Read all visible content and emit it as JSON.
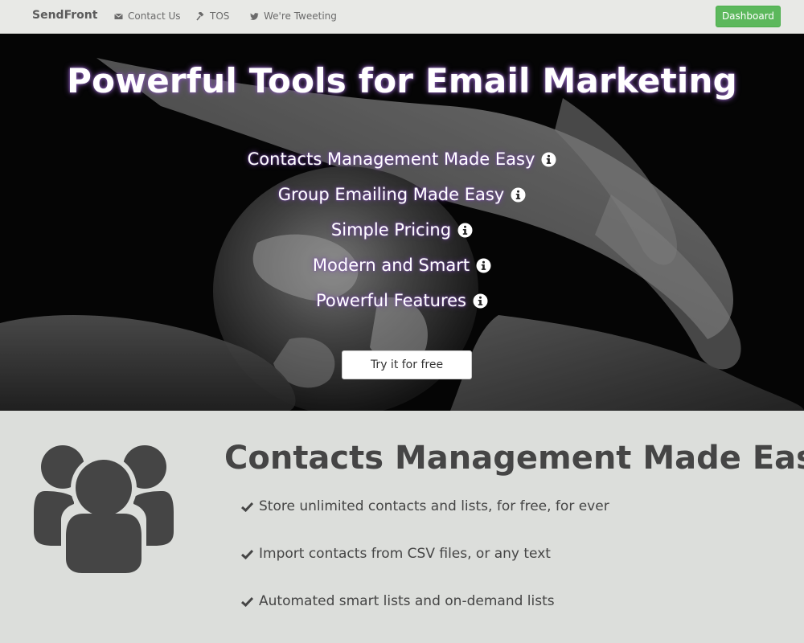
{
  "navbar": {
    "brand": "SendFront",
    "links": [
      {
        "label": "Contact Us",
        "icon": "envelope-icon"
      },
      {
        "label": "TOS",
        "icon": "gavel-icon"
      },
      {
        "label": "We're Tweeting",
        "icon": "twitter-icon"
      }
    ],
    "dashboard_label": "Dashboard"
  },
  "hero": {
    "title": "Powerful Tools for Email Marketing",
    "features": [
      "Contacts Management Made Easy",
      "Group Emailing Made Easy",
      "Simple Pricing",
      "Modern and Smart",
      "Powerful Features"
    ],
    "cta_label": "Try it for free"
  },
  "section": {
    "icon": "users-icon",
    "title": "Contacts Management Made Easy",
    "bullets": [
      "Store unlimited contacts and lists, for free, for ever",
      "Import contacts from CSV files, or any text",
      "Automated smart lists and on-demand lists"
    ]
  },
  "colors": {
    "navbar_bg": "#e8e9e6",
    "dashboard_green": "#5cb85c",
    "section_bg": "#dcdedb",
    "text_dark": "#454545",
    "hero_glow": "#7a4fa6"
  }
}
